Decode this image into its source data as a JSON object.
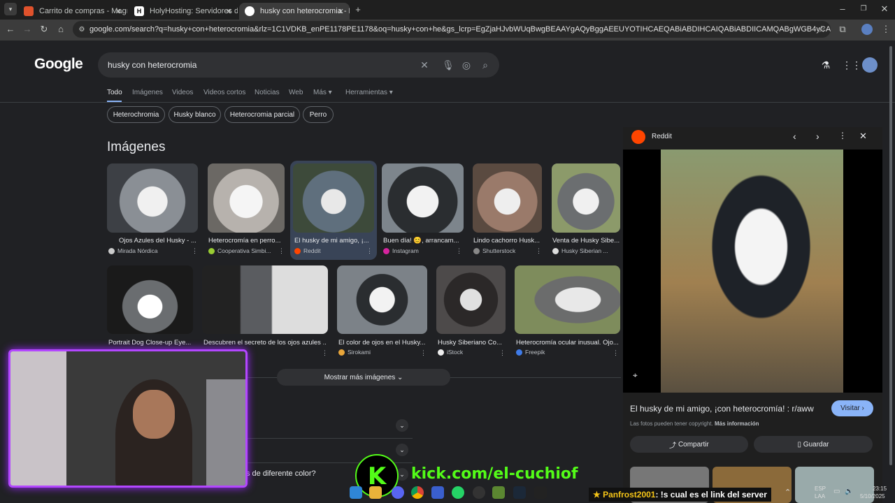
{
  "browser": {
    "tabs": [
      {
        "title": "Carrito de compras - Magmang",
        "active": false
      },
      {
        "title": "HolyHosting: Servidores de Mi",
        "active": false
      },
      {
        "title": "husky con heterocromia - Busc",
        "active": true
      }
    ],
    "url": "google.com/search?q=husky+con+heterocromia&rlz=1C1VDKB_enPE1178PE1178&oq=husky+con+he&gs_lcrp=EgZjaHJvbWUqBwgBEAAYgAQyBggAEEUYOTIHCAEQABiABDIHCAIQABiABDIICAMQABgWGB4yCAgEEAAYFhgeMggIBRAAGBYYHjIICAY..."
  },
  "google": {
    "logo": "Google",
    "query": "husky con heterocromia",
    "nav": [
      "Todo",
      "Imágenes",
      "Videos",
      "Videos cortos",
      "Noticias",
      "Web",
      "Más ▾",
      "Herramientas ▾"
    ],
    "chips": [
      "Heterochromia",
      "Husky blanco",
      "Heterocromia parcial",
      "Perro"
    ],
    "images_heading": "Imágenes",
    "row1": [
      {
        "caption": "Ojos Azules del Husky - ...",
        "source": "Mirada Nórdica",
        "color": "#8a8f95"
      },
      {
        "caption": "Heterocromía en perro...",
        "source": "Cooperativa Simbi...",
        "color": "#b7b2ad"
      },
      {
        "caption": "El husky de mi amigo, ¡...",
        "source": "Reddit",
        "color": "#5f6f7d"
      },
      {
        "caption": "Buen día! 😊, arrancam...",
        "source": "Instagram",
        "color": "#7d858c"
      },
      {
        "caption": "Lindo cachorro Husk...",
        "source": "Shutterstock",
        "color": "#9a7a6a"
      },
      {
        "caption": "Venta de Husky Sibe...",
        "source": "Husky Siberian ...",
        "color": "#8c9a6a"
      }
    ],
    "row2": [
      {
        "caption": "Portrait Dog Close-up Eye...",
        "source": "",
        "color": "#6a6d70"
      },
      {
        "caption": "Descubren el secreto de los ojos azules ...",
        "source": "",
        "color": "#5a5c60"
      },
      {
        "caption": "El color de ojos en el Husky...",
        "source": "Sirokami",
        "color": "#7c8288"
      },
      {
        "caption": "Husky Siberiano Co...",
        "source": "iStock",
        "color": "#4d4a4a"
      },
      {
        "caption": "Heterocromía ocular inusual. Ojo...",
        "source": "Freepik",
        "color": "#7e8c5c"
      }
    ],
    "more_images": "Mostrar más imágenes",
    "faq_visible": [
      "?",
      "s de diferente color?"
    ]
  },
  "panel": {
    "source": "Reddit",
    "title": "El husky de mi amigo, ¡con heterocromía! : r/aww",
    "visit": "Visitar",
    "copyright": "Las fotos pueden tener copyright.",
    "more_info": "Más información",
    "share": "Compartir",
    "save": "Guardar"
  },
  "overlay": {
    "kick_url": "kick.com/el-cuchiof",
    "chat_user": "Panfrost2001",
    "chat_msg": ": !s cual es el link del server"
  },
  "tray": {
    "lang": "ESP",
    "layout": "LAA",
    "time": "23:15",
    "date": "5/10/2025"
  }
}
